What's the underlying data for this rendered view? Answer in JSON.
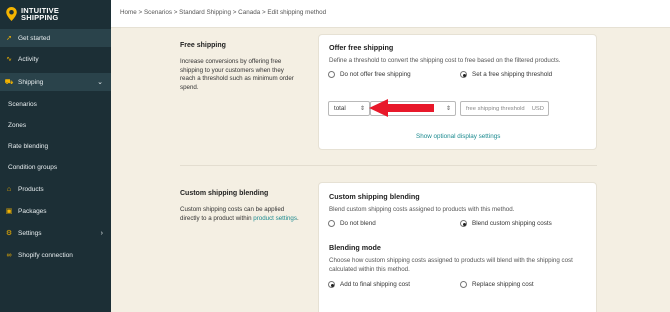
{
  "brand": {
    "line1": "INTUITIVE",
    "line2": "SHIPPING"
  },
  "breadcrumb": "Home > Scenarios > Standard Shipping > Canada > Edit shipping method",
  "sidebar": {
    "items": [
      {
        "label": "Get started",
        "icon": "rocket-icon"
      },
      {
        "label": "Activity",
        "icon": "pulse-icon"
      },
      {
        "label": "Shipping",
        "icon": "truck-icon"
      },
      {
        "label": "Scenarios"
      },
      {
        "label": "Zones"
      },
      {
        "label": "Rate blending"
      },
      {
        "label": "Condition groups"
      },
      {
        "label": "Products",
        "icon": "tag-icon"
      },
      {
        "label": "Packages",
        "icon": "box-icon"
      },
      {
        "label": "Settings",
        "icon": "gear-icon"
      },
      {
        "label": "Shopify connection",
        "icon": "link-icon"
      }
    ]
  },
  "free_shipping": {
    "title": "Free shipping",
    "description": "Increase conversions by offering free shipping to your customers when they reach a threshold such as minimum order spend.",
    "card_title": "Offer free shipping",
    "card_desc": "Define a threshold to convert the shipping cost to free based on the filtered products.",
    "option_off": "Do not offer free shipping",
    "option_on": "Set a free shipping threshold",
    "metric_value": "total",
    "threshold_placeholder": "free shipping threshold",
    "currency": "USD",
    "optional_link": "Show optional display settings"
  },
  "blending": {
    "title": "Custom shipping blending",
    "desc_before": "Custom shipping costs can be applied directly to a product within ",
    "desc_link": "product settings",
    "desc_after": ".",
    "card_title": "Custom shipping blending",
    "card_desc": "Blend custom shipping costs assigned to products with this method.",
    "option_off": "Do not blend",
    "option_on": "Blend custom shipping costs",
    "mode_title": "Blending mode",
    "mode_desc": "Choose how custom shipping costs assigned to products will blend with the shipping cost calculated within this method.",
    "mode_add": "Add to final shipping cost",
    "mode_replace": "Replace shipping cost"
  },
  "colors": {
    "sidebar": "#1c2f36",
    "accent": "#f4b400",
    "link": "#1b8a8f",
    "arrow": "#e8182a",
    "page_bg": "#f4efe3"
  }
}
